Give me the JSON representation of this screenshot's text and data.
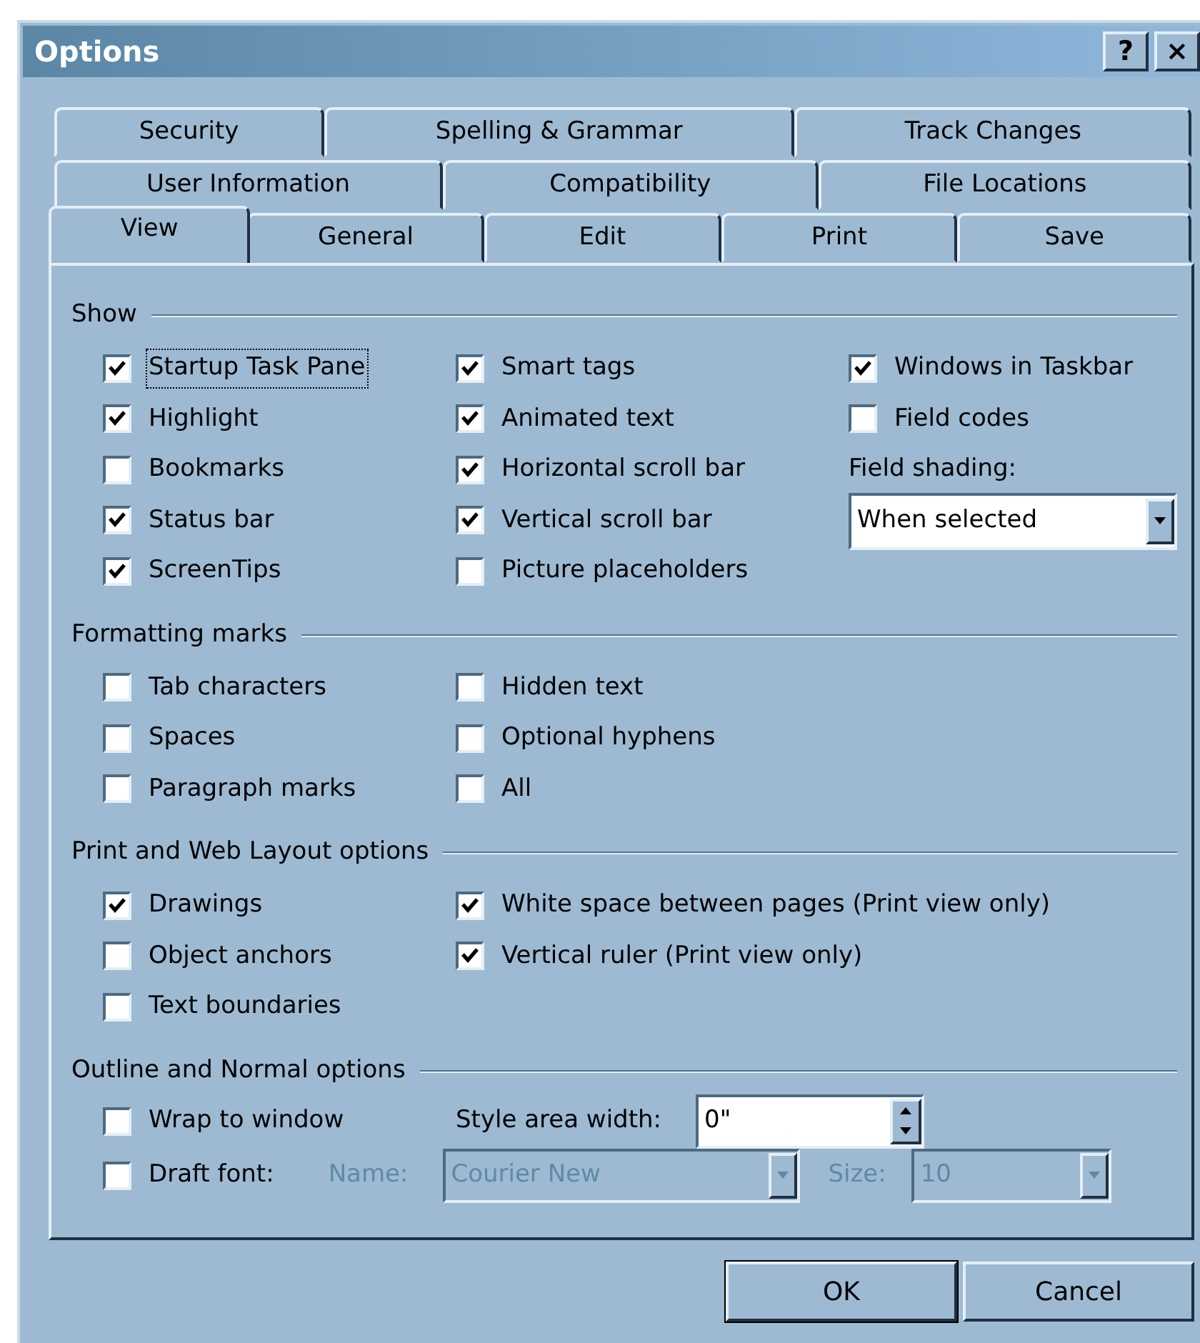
{
  "window": {
    "title": "Options",
    "buttons": [
      "?",
      "×"
    ]
  },
  "tab_rows": [
    [
      {
        "label": "Security",
        "selected": false
      },
      {
        "label": "Spelling & Grammar",
        "selected": false
      },
      {
        "label": "Track Changes",
        "selected": false
      }
    ],
    [
      {
        "label": "User Information",
        "selected": false
      },
      {
        "label": "Compatibility",
        "selected": false
      },
      {
        "label": "File Locations",
        "selected": false
      }
    ],
    [
      {
        "label": "View",
        "selected": true
      },
      {
        "label": "General",
        "selected": false
      },
      {
        "label": "Edit",
        "selected": false
      },
      {
        "label": "Print",
        "selected": false
      },
      {
        "label": "Save",
        "selected": false
      }
    ]
  ],
  "sections": [
    {
      "title": "Show",
      "columns": [
        [
          {
            "kind": "checkbox",
            "label": "Startup Task Pane",
            "checked": true,
            "focused": true
          },
          {
            "kind": "checkbox",
            "label": "Highlight",
            "checked": true,
            "focused": false
          },
          {
            "kind": "checkbox",
            "label": "Bookmarks",
            "checked": false,
            "focused": false
          },
          {
            "kind": "checkbox",
            "label": "Status bar",
            "checked": true,
            "focused": false
          },
          {
            "kind": "checkbox",
            "label": "ScreenTips",
            "checked": true,
            "focused": false
          }
        ],
        [
          {
            "kind": "checkbox",
            "label": "Smart tags",
            "checked": true,
            "focused": false
          },
          {
            "kind": "checkbox",
            "label": "Animated text",
            "checked": true,
            "focused": false
          },
          {
            "kind": "checkbox",
            "label": "Horizontal scroll bar",
            "checked": true,
            "focused": false
          },
          {
            "kind": "checkbox",
            "label": "Vertical scroll bar",
            "checked": true,
            "focused": false
          },
          {
            "kind": "checkbox",
            "label": "Picture placeholders",
            "checked": false,
            "focused": false
          }
        ],
        [
          {
            "kind": "checkbox",
            "label": "Windows in Taskbar",
            "checked": true,
            "focused": false
          },
          {
            "kind": "checkbox",
            "label": "Field codes",
            "checked": false,
            "focused": false
          },
          {
            "kind": "label",
            "label": "Field shading:"
          },
          {
            "kind": "dropdown",
            "value": "When selected"
          }
        ]
      ]
    },
    {
      "title": "Formatting marks",
      "columns": [
        [
          {
            "kind": "checkbox",
            "label": "Tab characters",
            "checked": false,
            "focused": false
          },
          {
            "kind": "checkbox",
            "label": "Spaces",
            "checked": false,
            "focused": false
          },
          {
            "kind": "checkbox",
            "label": "Paragraph marks",
            "checked": false,
            "focused": false
          }
        ],
        [
          {
            "kind": "checkbox",
            "label": "Hidden text",
            "checked": false,
            "focused": false
          },
          {
            "kind": "checkbox",
            "label": "Optional hyphens",
            "checked": false,
            "focused": false
          },
          {
            "kind": "checkbox",
            "label": "All",
            "checked": false,
            "focused": false
          }
        ]
      ]
    },
    {
      "title": "Print and Web Layout options",
      "columns": [
        [
          {
            "kind": "checkbox",
            "label": "Drawings",
            "checked": true,
            "focused": false
          },
          {
            "kind": "checkbox",
            "label": "Object anchors",
            "checked": false,
            "focused": false
          },
          {
            "kind": "checkbox",
            "label": "Text boundaries",
            "checked": false,
            "focused": false
          }
        ],
        [
          {
            "kind": "checkbox",
            "label": "White space between pages (Print view only)",
            "checked": true,
            "focused": false
          },
          {
            "kind": "checkbox",
            "label": "Vertical ruler (Print view only)",
            "checked": true,
            "focused": false
          }
        ]
      ]
    },
    {
      "title": "Outline and Normal options",
      "lines": [
        {
          "items": [
            {
              "kind": "checkbox",
              "label": "Wrap to window",
              "checked": false
            },
            {
              "kind": "label",
              "label": "Style area width:",
              "disabled": false
            },
            {
              "kind": "spinner",
              "value": "0\""
            }
          ]
        },
        {
          "items": [
            {
              "kind": "checkbox",
              "label": "Draft font:",
              "checked": false
            },
            {
              "kind": "label",
              "label": "Name:",
              "disabled": true
            },
            {
              "kind": "dropdown",
              "value": "Courier New",
              "disabled": true
            },
            {
              "kind": "label",
              "label": "Size:",
              "disabled": true
            },
            {
              "kind": "dropdown",
              "value": "10",
              "disabled": true
            }
          ]
        }
      ]
    }
  ],
  "buttons": [
    "OK",
    "Cancel"
  ]
}
